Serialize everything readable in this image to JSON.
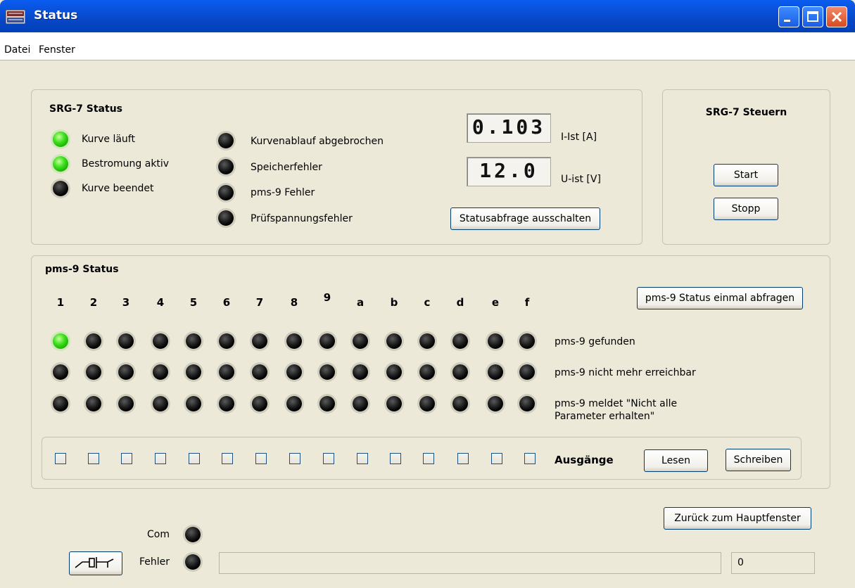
{
  "window": {
    "title": "Status"
  },
  "menu": {
    "items": [
      "Datei",
      "Fenster"
    ]
  },
  "srg_status": {
    "title": "SRG-7 Status",
    "left_indicators": [
      {
        "label": "Kurve läuft",
        "state": "on"
      },
      {
        "label": "Bestromung aktiv",
        "state": "on"
      },
      {
        "label": "Kurve beendet",
        "state": "off"
      }
    ],
    "right_indicators": [
      {
        "label": "Kurvenablauf abgebrochen",
        "state": "off"
      },
      {
        "label": "Speicherfehler",
        "state": "off"
      },
      {
        "label": "pms-9 Fehler",
        "state": "off"
      },
      {
        "label": "Prüfspannungsfehler",
        "state": "off"
      }
    ],
    "current_value": "0.103",
    "current_label": "I-Ist [A]",
    "voltage_value": "12.0",
    "voltage_label": "U-ist [V]",
    "toggle_button": "Statusabfrage ausschalten"
  },
  "srg_control": {
    "title": "SRG-7 Steuern",
    "start_label": "Start",
    "stop_label": "Stopp"
  },
  "pms_status": {
    "title": "pms-9 Status",
    "query_button": "pms-9 Status einmal abfragen",
    "columns": [
      "1",
      "2",
      "3",
      "4",
      "5",
      "6",
      "7",
      "8",
      "9",
      "a",
      "b",
      "c",
      "d",
      "e",
      "f"
    ],
    "rows": [
      {
        "label": "pms-9 gefunden",
        "states": [
          "on",
          "off",
          "off",
          "off",
          "off",
          "off",
          "off",
          "off",
          "off",
          "off",
          "off",
          "off",
          "off",
          "off",
          "off"
        ]
      },
      {
        "label": "pms-9 nicht mehr erreichbar",
        "states": [
          "off",
          "off",
          "off",
          "off",
          "off",
          "off",
          "off",
          "off",
          "off",
          "off",
          "off",
          "off",
          "off",
          "off",
          "off"
        ]
      },
      {
        "label": "pms-9 meldet \"Nicht alle",
        "label2": "Parameter erhalten\"",
        "states": [
          "off",
          "off",
          "off",
          "off",
          "off",
          "off",
          "off",
          "off",
          "off",
          "off",
          "off",
          "off",
          "off",
          "off",
          "off"
        ]
      }
    ],
    "outputs_label": "Ausgänge",
    "outputs_checked": [
      false,
      false,
      false,
      false,
      false,
      false,
      false,
      false,
      false,
      false,
      false,
      false,
      false,
      false,
      false
    ],
    "read_button": "Lesen",
    "write_button": "Schreiben"
  },
  "footer": {
    "back_button": "Zurück zum Hauptfenster",
    "com_label": "Com",
    "com_state": "off",
    "error_label": "Fehler",
    "error_state": "off",
    "counter_value": "0"
  },
  "colors": {
    "titlebar": "#0a5cf0",
    "led_on": "#3fe01f",
    "led_off": "#000000",
    "background": "#ece9d8"
  }
}
